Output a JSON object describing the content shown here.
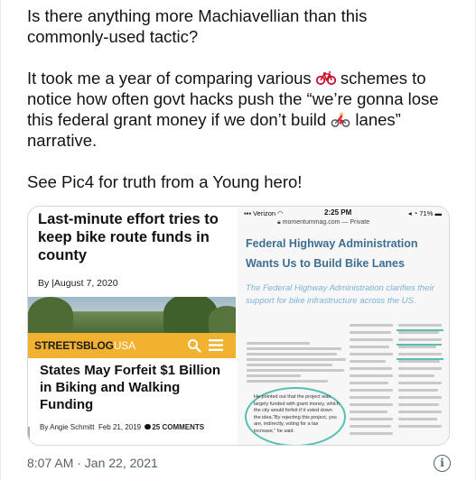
{
  "tweet": {
    "paragraphs": [
      {
        "parts": [
          "Is there anything more Machiavellian than this commonly-used tactic?"
        ]
      },
      {
        "parts": [
          "It took me a year of comparing various ",
          " schemes to notice how often govt hacks push the “we’re gonna lose this federal grant money if we don’t build ",
          " lanes” narrative."
        ]
      },
      {
        "parts": [
          "See Pic4 for truth from a Young hero!"
        ]
      }
    ],
    "emojis": [
      "bicycle-icon",
      "cyclist-icon"
    ],
    "timestamp": "8:07 AM · Jan 22, 2021",
    "info_icon": "info-icon"
  },
  "media": {
    "left": {
      "headline": "Last-minute effort tries to keep bike route funds in county",
      "byline": "By |August 7, 2020",
      "site_logo_main": "STREETSBLOG",
      "site_logo_suffix": "USA",
      "headline2": "States May Forfeit $1 Billion in Biking and Walking Funding",
      "byline2_author": "By Angie Schmitt",
      "byline2_date": "Feb 21, 2019",
      "byline2_comments": "25 COMMENTS",
      "accent_color": "#f2b230"
    },
    "right": {
      "carrier": "Verizon",
      "time": "2:25 PM",
      "battery": "71%",
      "url": "momentummag.com — Private",
      "title": "Federal Highway Administration Wants Us to Build Bike Lanes",
      "subtitle": "The Federal Highway Administration clarifies their support for bike infrastructure across the US.",
      "quote": "He pointed out that the project was largely funded with grant money, which the city would forfeit if it voted down the idea.“By rejecting this project, you are, indirectly, voting for a tax increase,” he said.",
      "title_color": "#3e6f93",
      "highlight_color": "#58c0b2"
    }
  }
}
